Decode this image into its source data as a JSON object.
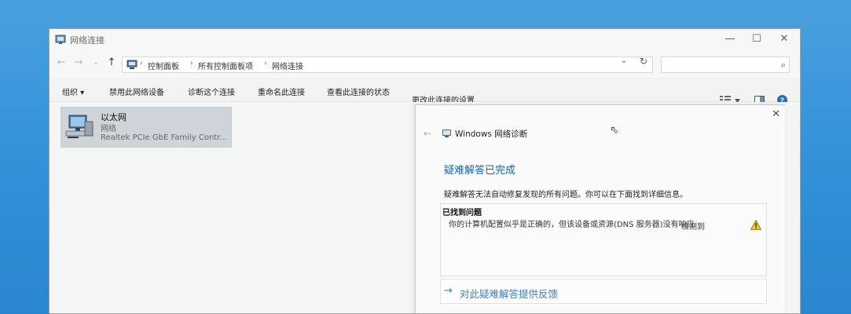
{
  "window": {
    "title": "网络连接",
    "minimize": "—",
    "maximize": "☐",
    "close": "✕"
  },
  "nav": {
    "back": "←",
    "forward": "→",
    "recent": "⌄",
    "up": "↑"
  },
  "address": {
    "crumbs": [
      "控制面板",
      "所有控制面板项",
      "网络连接"
    ],
    "separator": "›",
    "dropdown": "⌄",
    "refresh": "↻"
  },
  "search": {
    "placeholder": "",
    "icon": "⌕"
  },
  "toolbar": {
    "organize": "组织 ▾",
    "disable": "禁用此网络设备",
    "diagnose": "诊断这个连接",
    "rename": "重命名此连接",
    "status": "查看此连接的状态",
    "settings": "更改此连接的设置"
  },
  "connection": {
    "name": "以太网",
    "type": "网络",
    "adapter": "Realtek PCIe GbE Family Contr..."
  },
  "dialog": {
    "close": "✕",
    "back": "←",
    "title": "Windows 网络诊断",
    "heading": "疑难解答已完成",
    "description": "疑难解答无法自动修复发现的所有问题。你可以在下面找到详细信息。",
    "found_header": "已找到问题",
    "problem": "你的计算机配置似乎是正确的，但该设备或资源(DNS 服务器)没有响应",
    "problem_status": "检测到",
    "feedback_arrow": "→",
    "feedback": "对此疑难解答提供反馈"
  },
  "colors": {
    "accent": "#1a64b0",
    "link": "#3e80c2",
    "warning": "#f2c811"
  }
}
